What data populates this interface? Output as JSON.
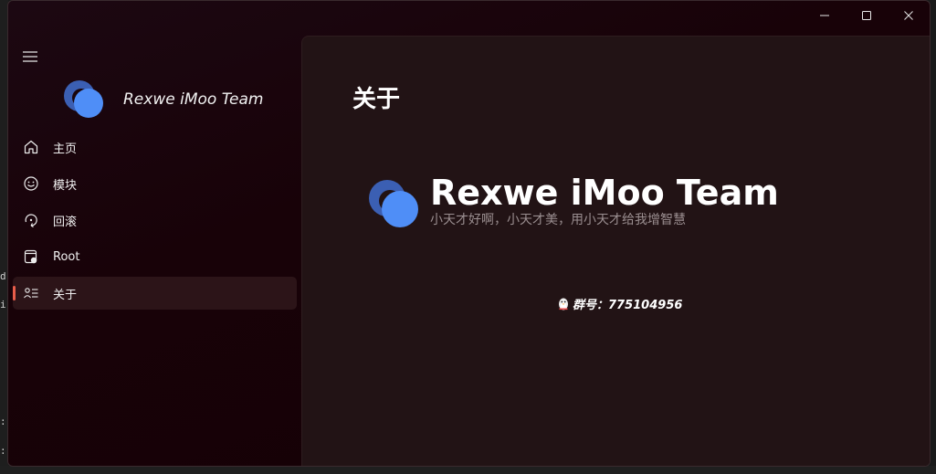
{
  "window": {
    "caption_buttons": [
      {
        "name": "minimize-icon"
      },
      {
        "name": "maximize-icon"
      },
      {
        "name": "close-icon"
      }
    ]
  },
  "sidebar": {
    "brand_name": "Rexwe iMoo Team",
    "items": [
      {
        "label": "主页",
        "icon": "home-icon",
        "selected": false
      },
      {
        "label": "模块",
        "icon": "smiley-icon",
        "selected": false
      },
      {
        "label": "回滚",
        "icon": "rollback-icon",
        "selected": false
      },
      {
        "label": "Root",
        "icon": "root-icon",
        "selected": false
      },
      {
        "label": "关于",
        "icon": "about-icon",
        "selected": true
      }
    ]
  },
  "main": {
    "title": "关于",
    "hero_title": "Rexwe iMoo Team",
    "hero_subtitle": "小天才好啊，小天才美，用小天才给我增智慧",
    "group_text": "群号：775104956"
  },
  "colors": {
    "accent": "#e85d4a",
    "logo_blue": "#4f8ef7",
    "logo_dark_blue": "#3b5fb3"
  }
}
